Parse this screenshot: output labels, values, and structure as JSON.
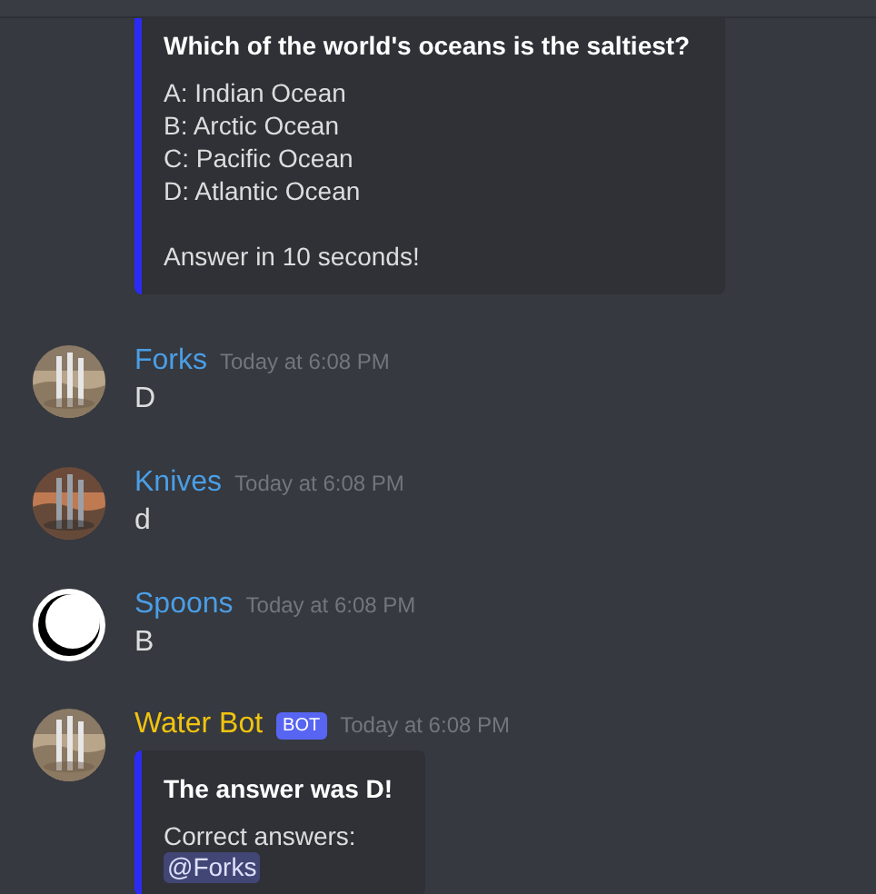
{
  "messages": [
    {
      "kind": "embed_only",
      "embed": {
        "title": "Which of the world's oceans is the saltiest?",
        "lines": [
          "A: Indian Ocean",
          "B: Arctic Ocean",
          "C: Pacific Ocean",
          "D: Atlantic Ocean"
        ],
        "footer": "Answer in 10 seconds!"
      }
    },
    {
      "kind": "user",
      "author": "Forks",
      "color": "#4a9ee6",
      "time": "Today at 6:08 PM",
      "text": "D"
    },
    {
      "kind": "user",
      "author": "Knives",
      "color": "#4a9ee6",
      "time": "Today at 6:08 PM",
      "text": "d"
    },
    {
      "kind": "user",
      "avatar": {
        "kind": "crescent"
      },
      "author": "Spoons",
      "color": "#4a9ee6",
      "time": "Today at 6:08 PM",
      "text": "B"
    },
    {
      "kind": "bot",
      "author": "Water Bot",
      "color": "#f1c40f",
      "tag": "BOT",
      "time": "Today at 6:08 PM",
      "embed": {
        "title": "The answer was D!",
        "text": "Correct answers:",
        "mentions": [
          "@Forks"
        ]
      }
    }
  ]
}
